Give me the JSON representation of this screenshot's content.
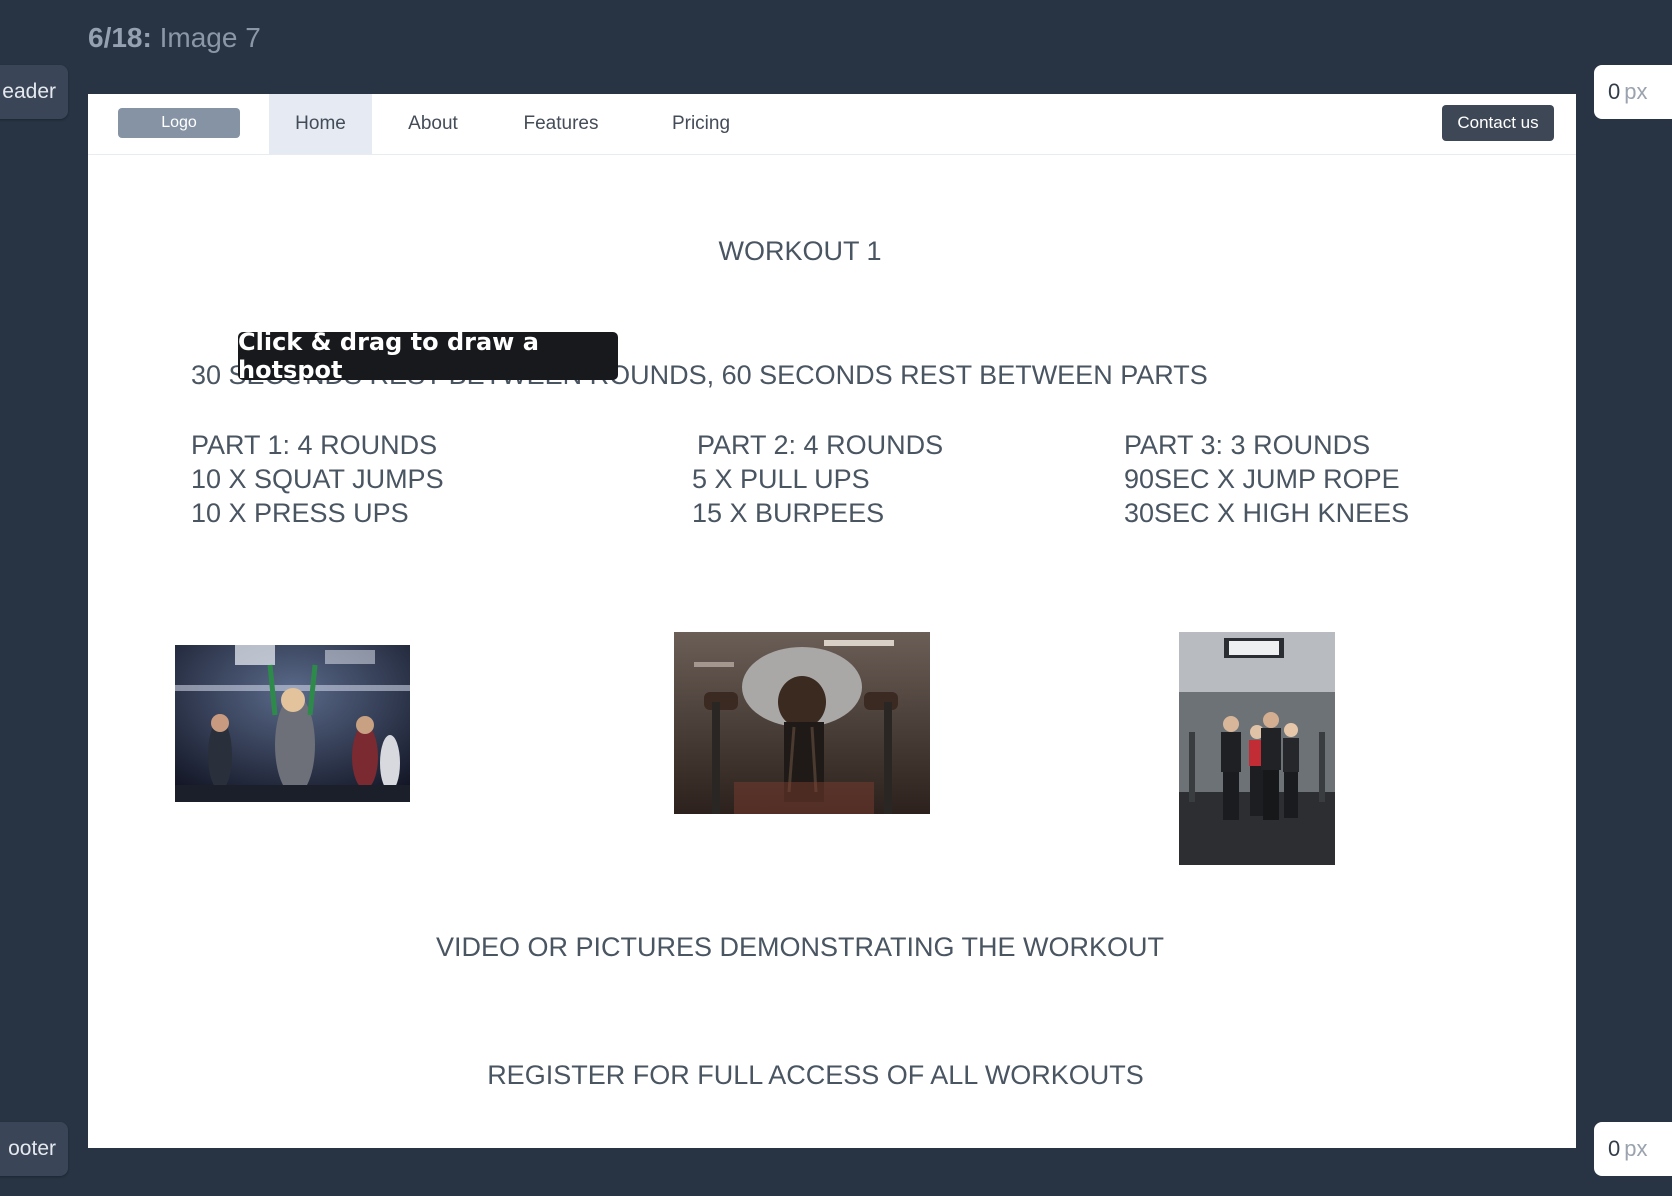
{
  "header": {
    "counter": "6/18:",
    "image_title": "Image 7"
  },
  "side_tabs": {
    "header_label": "eader",
    "footer_label": "ooter"
  },
  "px_inputs": {
    "top_value": "0",
    "bottom_value": "0",
    "unit": "px"
  },
  "nav": {
    "logo": "Logo",
    "items": [
      "Home",
      "About",
      "Features",
      "Pricing"
    ],
    "active_item": "Home",
    "contact": "Contact us"
  },
  "content": {
    "title": "WORKOUT 1",
    "rest_line": "30 SECONDS REST BETWEEN ROUNDS, 60 SECONDS REST BETWEEN PARTS",
    "parts": [
      {
        "heading": "PART 1: 4 ROUNDS",
        "lines": [
          "10 X SQUAT JUMPS",
          "10 X PRESS UPS"
        ]
      },
      {
        "heading": "PART 2: 4 ROUNDS",
        "lines": [
          "5 X PULL UPS",
          "15 X BURPEES"
        ]
      },
      {
        "heading": "PART 3: 3 ROUNDS",
        "lines": [
          "90SEC X JUMP ROPE",
          "30SEC X HIGH KNEES"
        ]
      }
    ],
    "demo_caption": "VIDEO OR PICTURES DEMONSTRATING THE WORKOUT",
    "register": "REGISTER FOR FULL ACCESS OF ALL WORKOUTS"
  },
  "tooltip": "Click & drag to draw a hotspot"
}
